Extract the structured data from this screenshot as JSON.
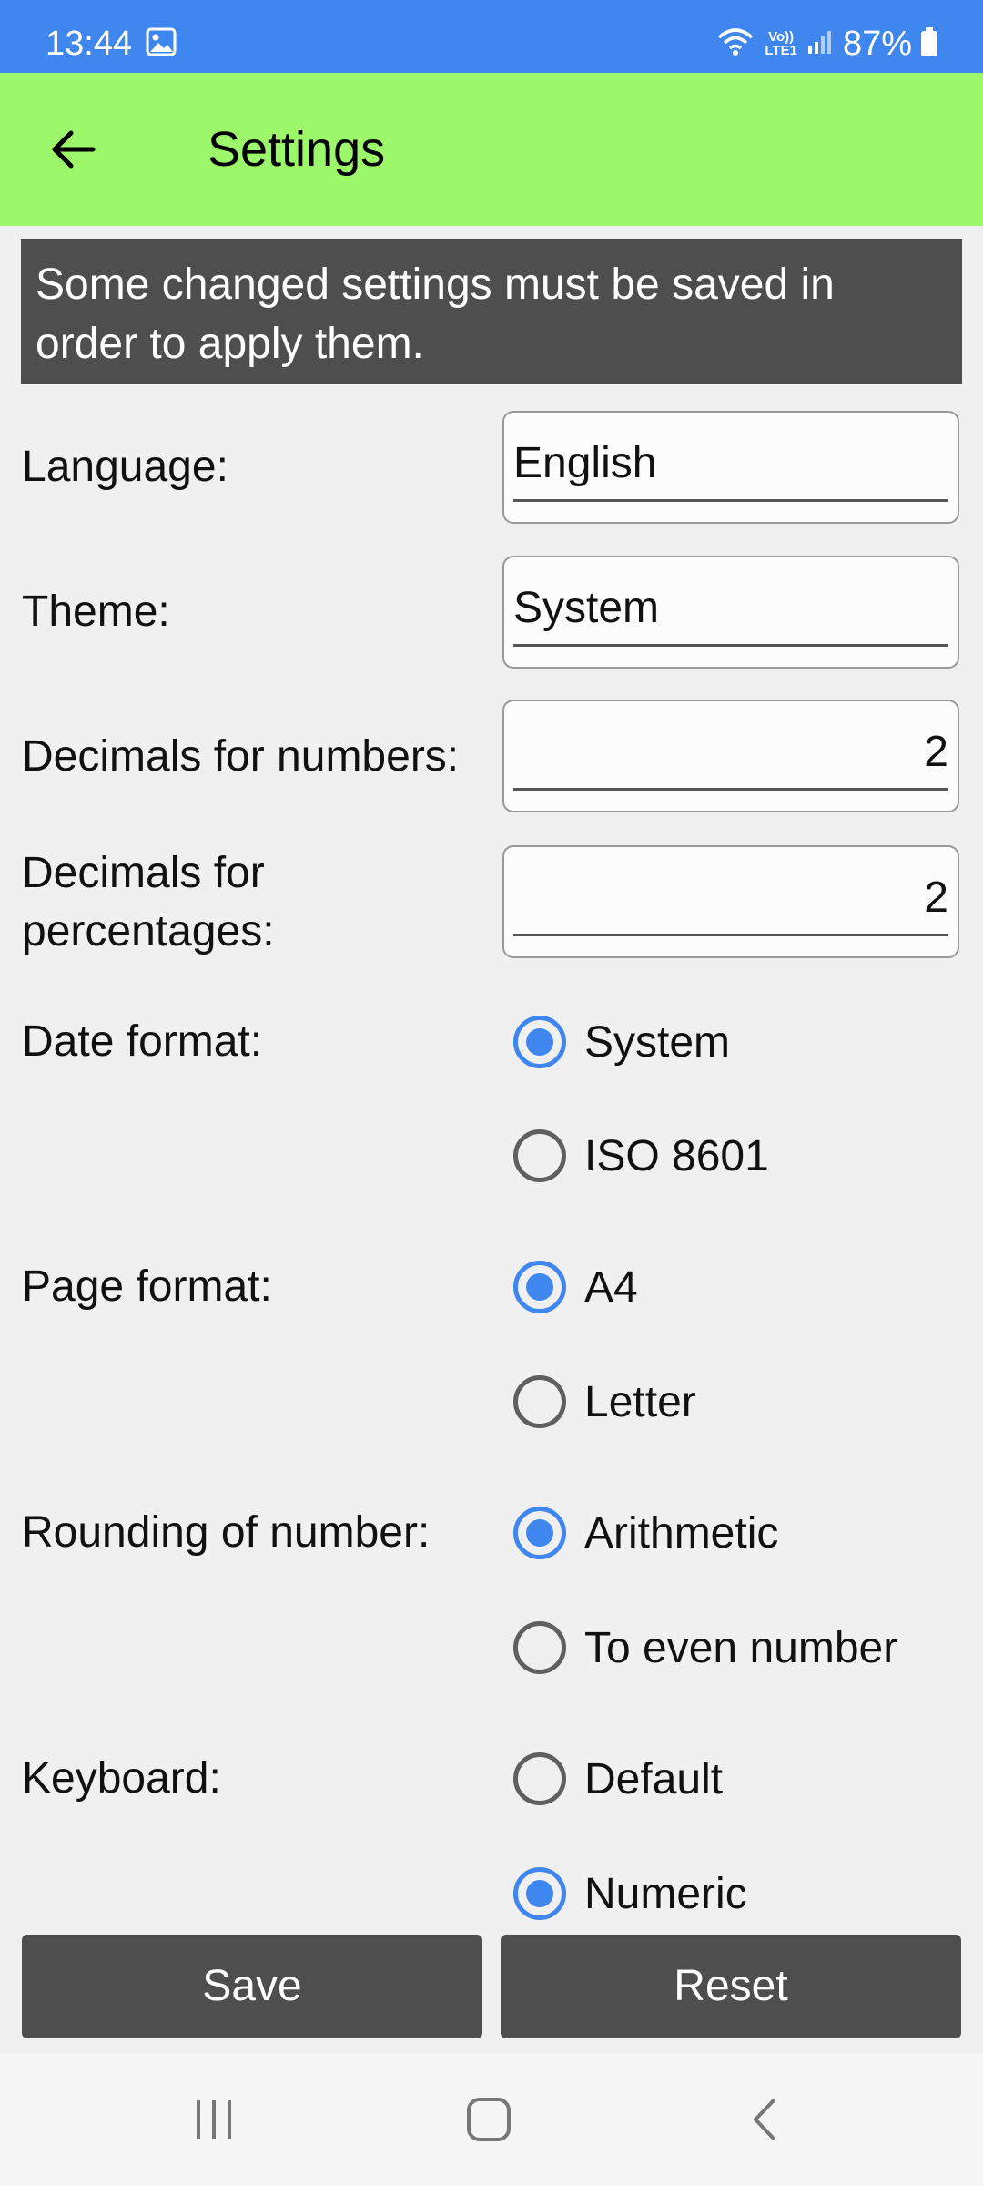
{
  "status_bar": {
    "time": "13:44",
    "battery": "87%",
    "volte_top": "Vo))",
    "volte_bottom": "LTE1",
    "icons": [
      "gallery-icon",
      "wifi-icon",
      "volte-icon",
      "signal-icon",
      "battery-icon"
    ]
  },
  "app_bar": {
    "title": "Settings",
    "back_icon": "arrow-left-icon",
    "background": "#9cf76a"
  },
  "notice": "Some changed settings must be saved in order to apply them.",
  "settings": {
    "language": {
      "label": "Language:",
      "value": "English"
    },
    "theme": {
      "label": "Theme:",
      "value": "System"
    },
    "decimals_numbers": {
      "label": "Decimals for numbers:",
      "value": "2"
    },
    "decimals_percentages": {
      "label_line1": "Decimals for",
      "label_line2": "percentages:",
      "value": "2"
    },
    "date_format": {
      "label": "Date format:",
      "options": [
        "System",
        "ISO 8601"
      ],
      "selected": "System"
    },
    "page_format": {
      "label": "Page format:",
      "options": [
        "A4",
        "Letter"
      ],
      "selected": "A4"
    },
    "rounding": {
      "label": "Rounding of number:",
      "options": [
        "Arithmetic",
        "To even number"
      ],
      "selected": "Arithmetic"
    },
    "keyboard": {
      "label": "Keyboard:",
      "options": [
        "Default",
        "Numeric"
      ],
      "selected": "Numeric"
    }
  },
  "buttons": {
    "save": "Save",
    "reset": "Reset"
  },
  "nav_bar": {
    "icons": [
      "recent-apps-icon",
      "home-icon",
      "back-icon"
    ]
  },
  "colors": {
    "accent": "#3f86ee",
    "status_bar": "#3f86ee",
    "dark_button": "#4e4e4e"
  }
}
